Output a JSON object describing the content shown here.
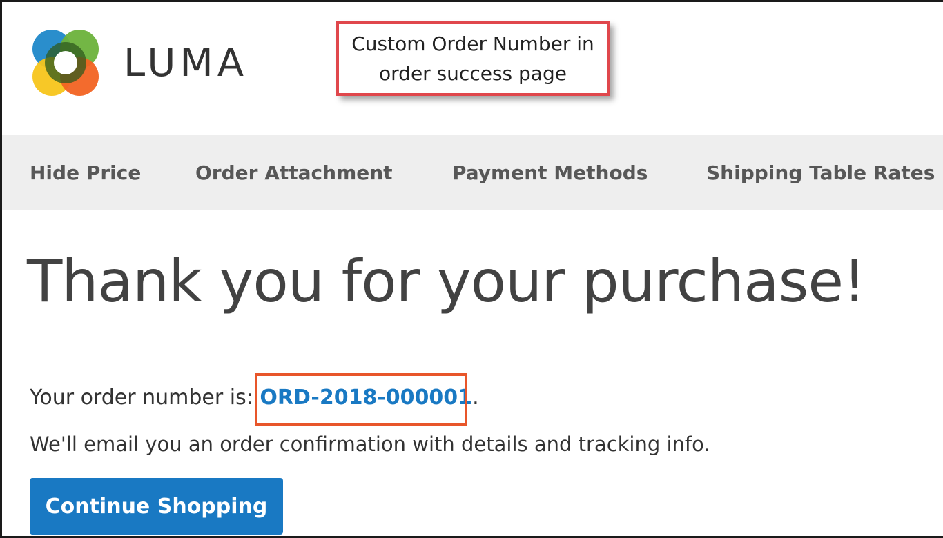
{
  "brand": {
    "name": "LUMA",
    "logo_icon": "luma-logo-icon",
    "colors": {
      "blue": "#1f88c9",
      "green": "#6cb23b",
      "yellow": "#f7c51b",
      "orange": "#f26322",
      "dark_green": "#2f5a1e"
    }
  },
  "callout": {
    "text_line1": "Custom Order Number in",
    "text_line2": "order success page",
    "border_color": "#e0474c"
  },
  "nav": {
    "items": [
      {
        "label": "Hide Price"
      },
      {
        "label": "Order Attachment"
      },
      {
        "label": "Payment Methods"
      },
      {
        "label": "Shipping Table Rates"
      }
    ]
  },
  "main": {
    "title": "Thank you for your purchase!",
    "order_prefix": "Your order number is: ",
    "order_number": "ORD-2018-000001",
    "order_suffix": ".",
    "confirmation": "We'll email you an order confirmation with details and tracking info.",
    "continue_button": "Continue Shopping",
    "accent_color": "#1979c3",
    "highlight_color": "#e8562a"
  }
}
